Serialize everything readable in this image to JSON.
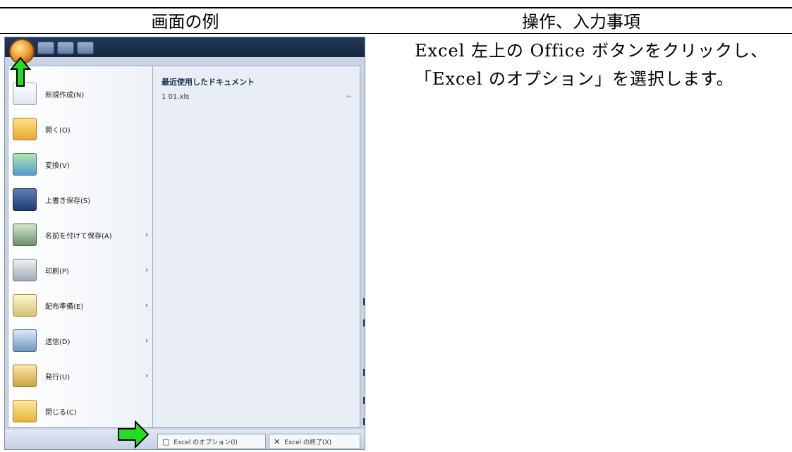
{
  "headers": {
    "left": "画面の例",
    "right": "操作、入力事項"
  },
  "recent": {
    "title": "最近使用したドキュメント",
    "item": "1 01.xls",
    "pin_icon": "pin-icon"
  },
  "menu": [
    {
      "name": "new",
      "label": "新規作成(N)",
      "icon": "new-document-icon",
      "has_sub": false
    },
    {
      "name": "open",
      "label": "開く(O)",
      "icon": "open-folder-icon",
      "has_sub": false
    },
    {
      "name": "convert",
      "label": "変換(V)",
      "icon": "convert-icon",
      "has_sub": false
    },
    {
      "name": "save",
      "label": "上書き保存(S)",
      "icon": "save-icon",
      "has_sub": false
    },
    {
      "name": "saveas",
      "label": "名前を付けて保存(A)",
      "icon": "save-as-icon",
      "has_sub": true
    },
    {
      "name": "print",
      "label": "印刷(P)",
      "icon": "print-icon",
      "has_sub": true
    },
    {
      "name": "prepare",
      "label": "配布準備(E)",
      "icon": "prepare-icon",
      "has_sub": true
    },
    {
      "name": "send",
      "label": "送信(D)",
      "icon": "send-icon",
      "has_sub": true
    },
    {
      "name": "publish",
      "label": "発行(U)",
      "icon": "publish-icon",
      "has_sub": true
    },
    {
      "name": "close",
      "label": "閉じる(C)",
      "icon": "close-folder-icon",
      "has_sub": false
    }
  ],
  "submenu_glyph": "›",
  "bottom": {
    "options_label": "Excel のオプション(I)",
    "exit_label": "Excel の終了(X)"
  },
  "description": "Excel 左上の Office ボタンをクリックし、「Excel のオプション」を選択します。",
  "colors": {
    "arrow_fill": "#22dd22",
    "arrow_stroke": "#000000"
  }
}
